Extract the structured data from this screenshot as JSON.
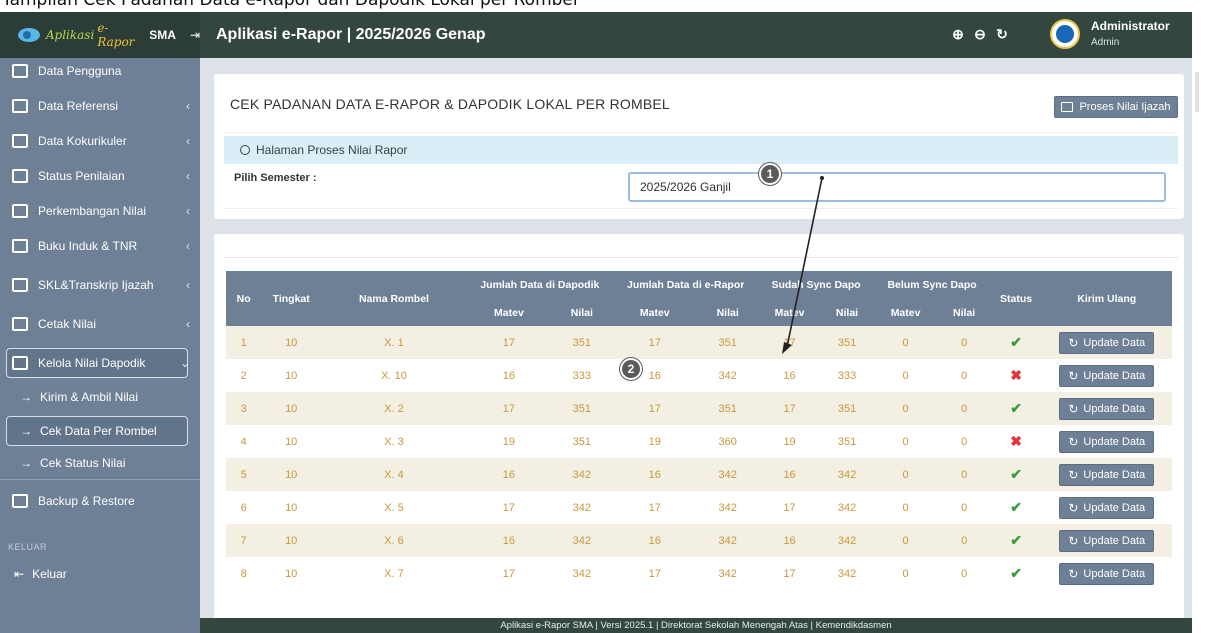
{
  "caption": "Tampilan Cek Padanan Data e-Rapor dan Dapodik Lokal per Rombel",
  "topbar": {
    "brand_1": "Aplikasi",
    "brand_2": "e-Rapor",
    "brand_3": "SMA",
    "brand_pin": "⇥",
    "title": "Aplikasi e-Rapor | 2025/2026 Genap",
    "user_name": "Administrator",
    "user_role": "Admin",
    "icons": [
      "zoom-in-icon",
      "zoom-out-icon",
      "reset-icon"
    ]
  },
  "sidebar": {
    "items": [
      {
        "label": "Data Pengguna",
        "icon": "user-list-icon",
        "chev": ""
      },
      {
        "label": "Data Referensi",
        "icon": "monitor-icon",
        "chev": "‹"
      },
      {
        "label": "Data Kokurikuler",
        "icon": "book-icon",
        "chev": "‹"
      },
      {
        "label": "Status Penilaian",
        "icon": "chart-icon",
        "chev": "‹"
      },
      {
        "label": "Perkembangan Nilai",
        "icon": "bar-chart-icon",
        "chev": "‹"
      },
      {
        "label": "Buku Induk & TNR",
        "icon": "ledger-icon",
        "chev": "‹"
      },
      {
        "label": "SKL&Transkrip Ijazah",
        "icon": "file-icon",
        "chev": "‹"
      },
      {
        "label": "Cetak Nilai",
        "icon": "printer-icon",
        "chev": "‹"
      },
      {
        "label": "Kelola Nilai Dapodik",
        "icon": "database-icon",
        "chev": "⌄"
      }
    ],
    "sub_items": [
      {
        "label": "Kirim & Ambil Nilai"
      },
      {
        "label": "Cek Data Per Rombel"
      },
      {
        "label": "Cek Status Nilai"
      }
    ],
    "backup_label": "Backup & Restore",
    "section_label": "KELUAR",
    "logout_label": "Keluar"
  },
  "card1": {
    "title": "CEK PADANAN DATA E-RAPOR & DAPODIK LOKAL PER ROMBEL",
    "btn_ijazah": "Proses Nilai Ijazah",
    "info": "Halaman Proses Nilai Rapor",
    "semester_label": "Pilih Semester :",
    "semester_value": "2025/2026 Ganjil"
  },
  "table": {
    "headers": {
      "no": "No",
      "tingkat": "Tingkat",
      "rombel": "Nama Rombel",
      "dapodik": "Jumlah Data di Dapodik",
      "erapor": "Jumlah Data di e-Rapor",
      "sudah": "Sudah Sync Dapo",
      "belum": "Belum Sync Dapo",
      "status": "Status",
      "kirim": "Kirim Ulang",
      "matev": "Matev",
      "nilai": "Nilai"
    },
    "rows": [
      {
        "no": "1",
        "tingkat": "10",
        "rombel": "X. 1",
        "d_matev": "17",
        "d_nilai": "351",
        "e_matev": "17",
        "e_nilai": "351",
        "s_matev": "17",
        "s_nilai": "351",
        "b_matev": "0",
        "b_nilai": "0",
        "status": "ok"
      },
      {
        "no": "2",
        "tingkat": "10",
        "rombel": "X. 10",
        "d_matev": "16",
        "d_nilai": "333",
        "e_matev": "16",
        "e_nilai": "342",
        "s_matev": "16",
        "s_nilai": "333",
        "b_matev": "0",
        "b_nilai": "0",
        "status": "fail"
      },
      {
        "no": "3",
        "tingkat": "10",
        "rombel": "X. 2",
        "d_matev": "17",
        "d_nilai": "351",
        "e_matev": "17",
        "e_nilai": "351",
        "s_matev": "17",
        "s_nilai": "351",
        "b_matev": "0",
        "b_nilai": "0",
        "status": "ok"
      },
      {
        "no": "4",
        "tingkat": "10",
        "rombel": "X. 3",
        "d_matev": "19",
        "d_nilai": "351",
        "e_matev": "19",
        "e_nilai": "360",
        "s_matev": "19",
        "s_nilai": "351",
        "b_matev": "0",
        "b_nilai": "0",
        "status": "fail"
      },
      {
        "no": "5",
        "tingkat": "10",
        "rombel": "X. 4",
        "d_matev": "16",
        "d_nilai": "342",
        "e_matev": "16",
        "e_nilai": "342",
        "s_matev": "16",
        "s_nilai": "342",
        "b_matev": "0",
        "b_nilai": "0",
        "status": "ok"
      },
      {
        "no": "6",
        "tingkat": "10",
        "rombel": "X. 5",
        "d_matev": "17",
        "d_nilai": "342",
        "e_matev": "17",
        "e_nilai": "342",
        "s_matev": "17",
        "s_nilai": "342",
        "b_matev": "0",
        "b_nilai": "0",
        "status": "ok"
      },
      {
        "no": "7",
        "tingkat": "10",
        "rombel": "X. 6",
        "d_matev": "16",
        "d_nilai": "342",
        "e_matev": "16",
        "e_nilai": "342",
        "s_matev": "16",
        "s_nilai": "342",
        "b_matev": "0",
        "b_nilai": "0",
        "status": "ok"
      },
      {
        "no": "8",
        "tingkat": "10",
        "rombel": "X. 7",
        "d_matev": "17",
        "d_nilai": "342",
        "e_matev": "17",
        "e_nilai": "342",
        "s_matev": "17",
        "s_nilai": "342",
        "b_matev": "0",
        "b_nilai": "0",
        "status": "ok"
      }
    ],
    "update_label": "Update Data",
    "status_ok_glyph": "✔",
    "status_fail_glyph": "✖"
  },
  "footer": "Aplikasi e-Rapor SMA | Versi 2025.1 | Direktorat Sekolah Menengah Atas | Kemendikdasmen",
  "annotations": {
    "badge_1": "1",
    "badge_2": "2"
  },
  "colors": {
    "topbar": "#33473f",
    "sidebar": "#6e8096",
    "header": "#6e8096",
    "ok": "#3a9b3a",
    "fail": "#e0363b",
    "cell_text": "#c9983e"
  }
}
